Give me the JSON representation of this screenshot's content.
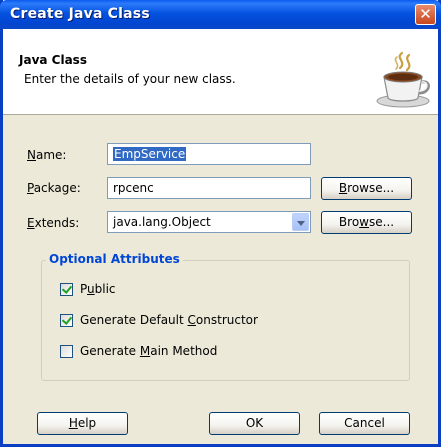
{
  "window": {
    "title": "Create Java Class",
    "close_glyph": "✕"
  },
  "header": {
    "title": "Java Class",
    "description": "Enter the details of your new class.",
    "icon": "java-coffee-cup-icon"
  },
  "form": {
    "name": {
      "label_key": "N",
      "label_rest": "ame:",
      "value": "EmpService"
    },
    "package": {
      "label_key": "P",
      "label_rest": "ackage:",
      "value": "rpcenc"
    },
    "extends": {
      "label_key": "E",
      "label_rest": "xtends:",
      "value": "java.lang.Object"
    },
    "browse_package": {
      "pre": "",
      "key": "B",
      "post": "rowse..."
    },
    "browse_extends": {
      "pre": "Bro",
      "key": "w",
      "post": "se..."
    }
  },
  "optional": {
    "title": "Optional Attributes",
    "public": {
      "pre": "P",
      "key": "u",
      "post": "blic",
      "checked": true
    },
    "constructor": {
      "pre": "Generate Default ",
      "key": "C",
      "post": "onstructor",
      "checked": true
    },
    "main": {
      "pre": "Generate ",
      "key": "M",
      "post": "ain Method",
      "checked": false
    }
  },
  "buttons": {
    "help": {
      "key": "H",
      "post": "elp"
    },
    "ok": "OK",
    "cancel": "Cancel"
  }
}
